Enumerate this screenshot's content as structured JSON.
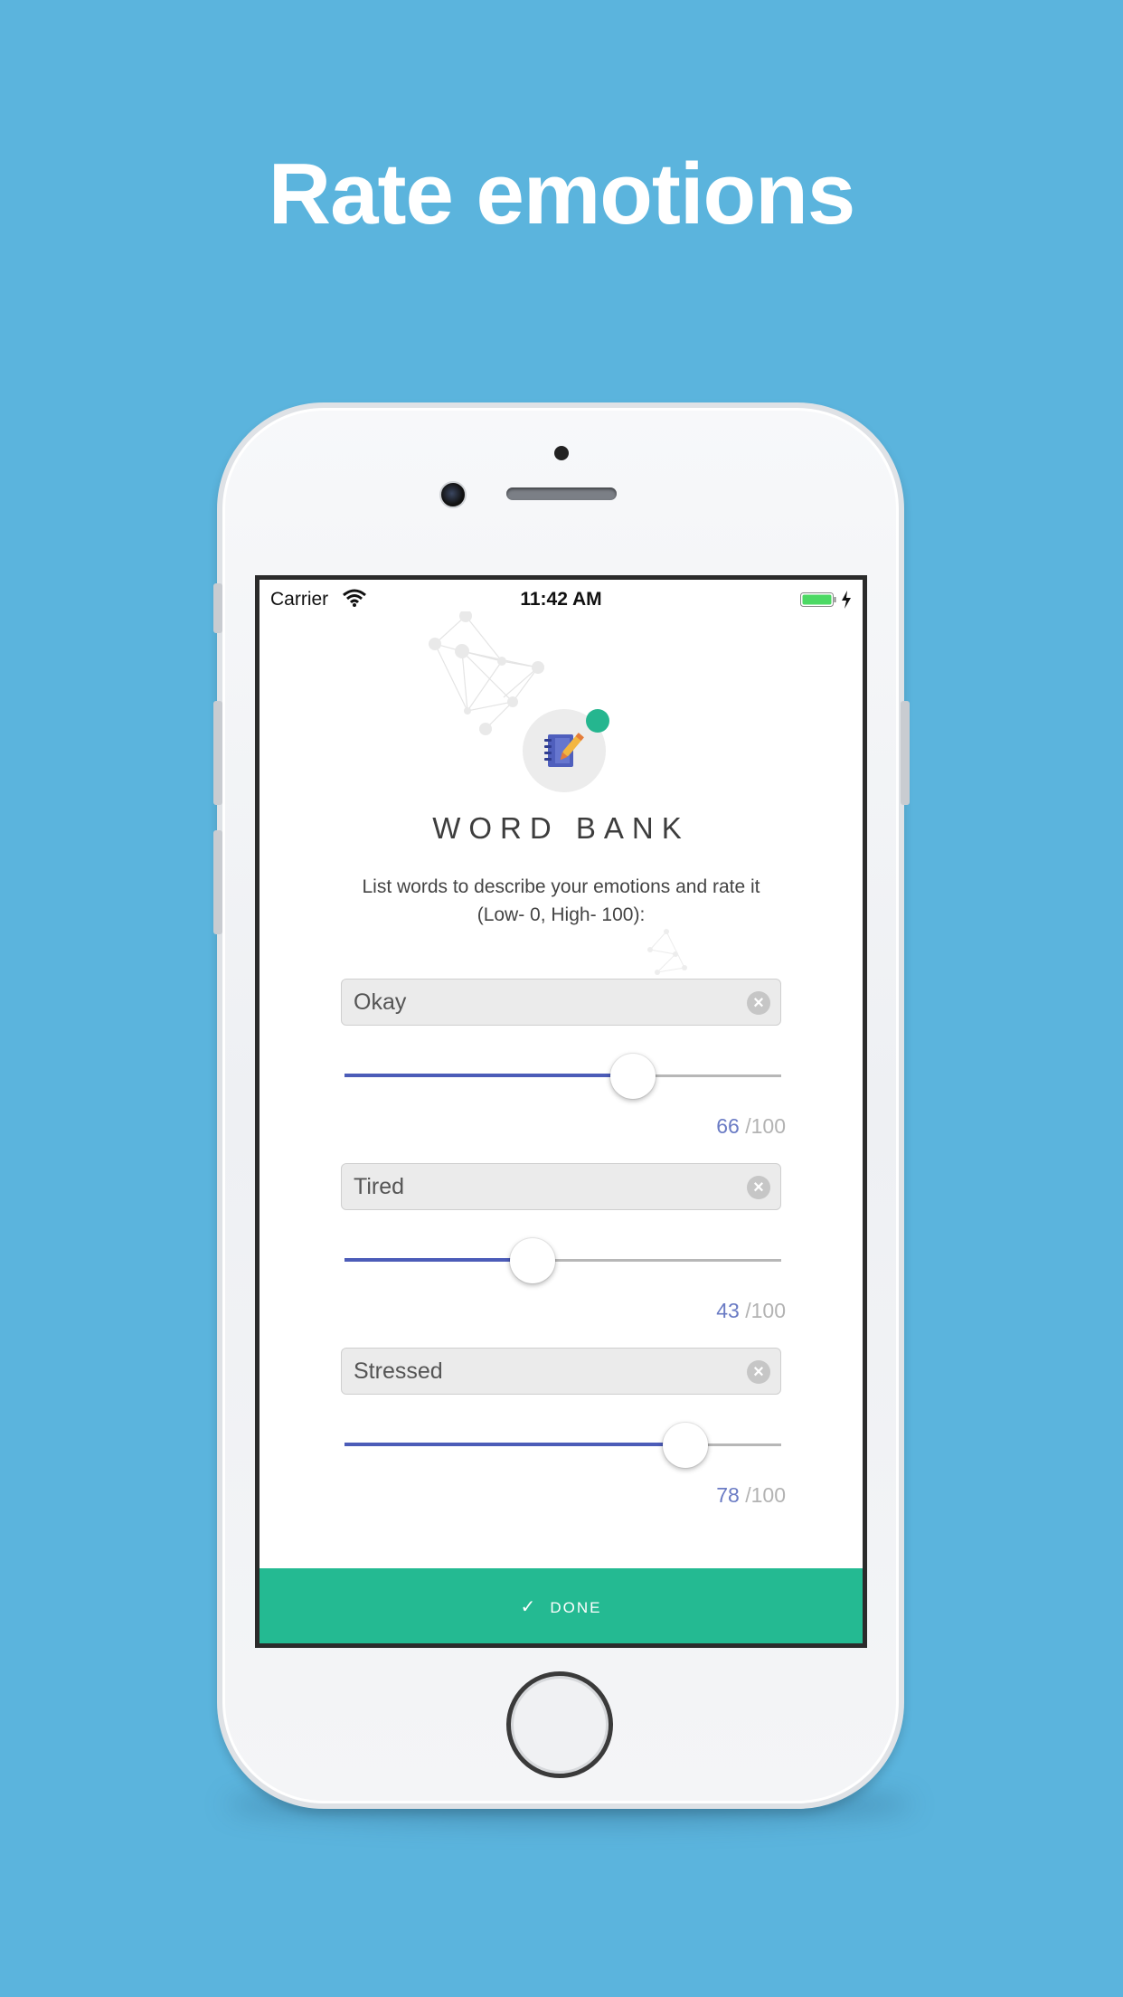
{
  "headline": "Rate emotions",
  "status_bar": {
    "carrier": "Carrier",
    "time": "11:42 AM"
  },
  "app": {
    "title": "WORD BANK",
    "instructions_line1": "List words to describe your emotions and rate it",
    "instructions_line2": "(Low- 0, High- 100):",
    "emotions": [
      {
        "word": "Okay",
        "rating": 66,
        "rating_display": "66",
        "max_display": "/100"
      },
      {
        "word": "Tired",
        "rating": 43,
        "rating_display": "43",
        "max_display": "/100"
      },
      {
        "word": "Stressed",
        "rating": 78,
        "rating_display": "78",
        "max_display": "/100"
      }
    ],
    "done_label": "DONE"
  },
  "colors": {
    "background": "#5bb4dd",
    "accent_green": "#24ba92",
    "slider_fill": "#4c5cb8",
    "rating_value": "#6a7bc4"
  },
  "icons": {
    "logo": "notebook-pencil-icon",
    "clear": "clear-x-icon",
    "done": "checkmark-icon"
  }
}
